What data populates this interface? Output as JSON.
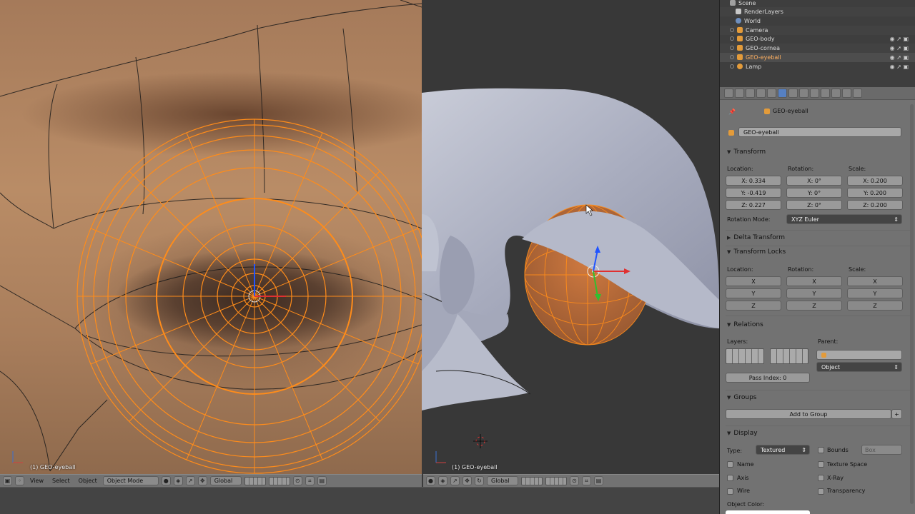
{
  "outliner": {
    "rows": [
      {
        "label": "Scene",
        "color": "#a0a0a0"
      },
      {
        "label": "RenderLayers",
        "color": "#c8c8c8"
      },
      {
        "label": "World",
        "color": "#6e8fbf"
      },
      {
        "label": "Camera",
        "color": "#e39b3a"
      },
      {
        "label": "GEO-body",
        "color": "#e39b3a"
      },
      {
        "label": "GEO-cornea",
        "color": "#e39b3a"
      },
      {
        "label": "GEO-eyeball",
        "color": "#e39b3a"
      },
      {
        "label": "Lamp",
        "color": "#e39b3a"
      }
    ]
  },
  "viewport_left": {
    "object_label": "(1) GEO-eyeball",
    "header": {
      "view": "View",
      "select": "Select",
      "object": "Object",
      "mode": "Object Mode",
      "orientation": "Global"
    }
  },
  "viewport_right": {
    "object_label": "(1) GEO-eyeball",
    "header": {
      "orientation": "Global"
    }
  },
  "properties": {
    "breadcrumb": "GEO-eyeball",
    "object_name": "GEO-eyeball",
    "transform": {
      "title": "Transform",
      "location_label": "Location:",
      "rotation_label": "Rotation:",
      "scale_label": "Scale:",
      "location": [
        "X: 0.334",
        "Y: -0.419",
        "Z: 0.227"
      ],
      "rotation": [
        "X: 0°",
        "Y: 0°",
        "Z: 0°"
      ],
      "scale": [
        "X: 0.200",
        "Y: 0.200",
        "Z: 0.200"
      ],
      "rotation_mode_label": "Rotation Mode:",
      "rotation_mode": "XYZ Euler"
    },
    "delta_transform": "Delta Transform",
    "transform_locks": {
      "title": "Transform Locks",
      "location_label": "Location:",
      "rotation_label": "Rotation:",
      "scale_label": "Scale:",
      "axes": [
        "X",
        "Y",
        "Z"
      ]
    },
    "relations": {
      "title": "Relations",
      "layers_label": "Layers:",
      "parent_label": "Parent:",
      "parent_type": "Object",
      "pass_index": "Pass Index: 0"
    },
    "groups": {
      "title": "Groups",
      "add_button": "Add to Group"
    },
    "display": {
      "title": "Display",
      "type_label": "Type:",
      "type_value": "Textured",
      "bounds_label": "Bounds",
      "bounds_value": "Box",
      "name": "Name",
      "texture_space": "Texture Space",
      "axis": "Axis",
      "xray": "X-Ray",
      "wire": "Wire",
      "transparency": "Transparency",
      "object_color": "Object Color:"
    }
  },
  "colors": {
    "wire_orange": "#ff8c1a",
    "selected_tab": "#5680c2"
  }
}
